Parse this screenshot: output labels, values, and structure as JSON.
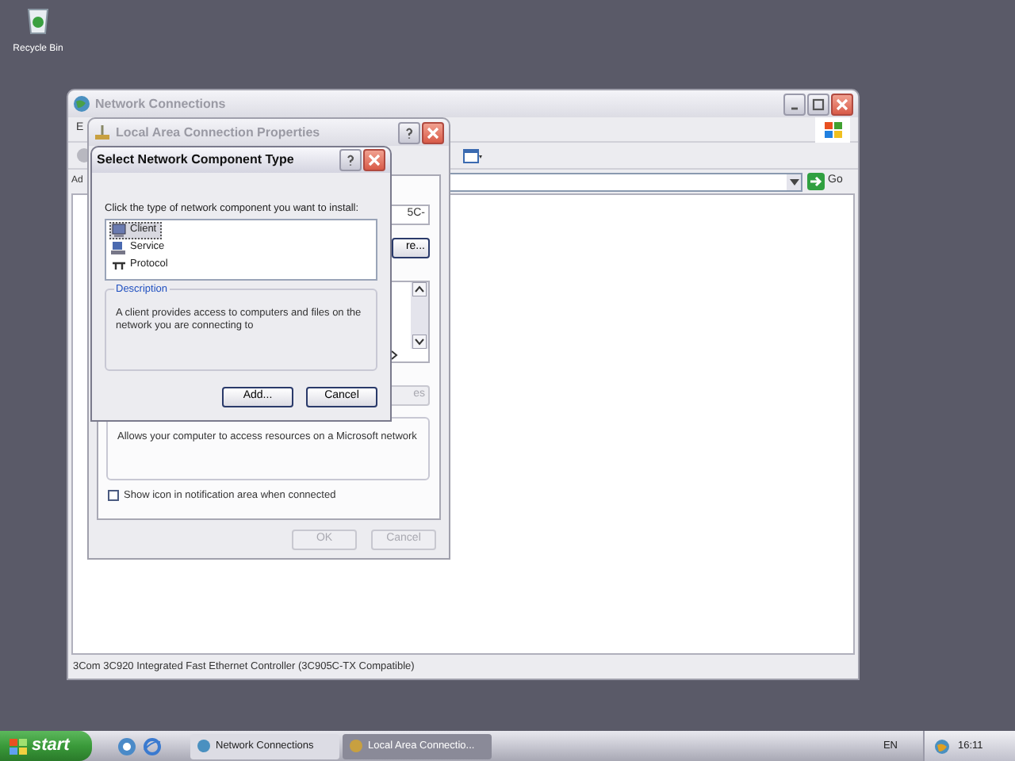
{
  "desktop_icons": [
    {
      "label": "Recycle Bin"
    }
  ],
  "network_connections": {
    "title": "Network Connections",
    "menu": [
      "E"
    ],
    "address_label": "Ad",
    "go": "Go",
    "status_bar": "3Com 3C920 Integrated Fast Ethernet Controller (3C905C-TX Compatible)"
  },
  "properties": {
    "title": "Local Area Connection Properties",
    "adapter_field": "5C-",
    "configure_button": "re...",
    "properties_button": "es",
    "description": "Allows your computer to access resources on a Microsoft network",
    "show_icon": {
      "label": "Show icon in notification area when connected",
      "checked": false
    },
    "buttons": [
      {
        "label": "OK",
        "disabled": true
      },
      {
        "label": "Cancel",
        "disabled": true
      }
    ]
  },
  "dialog": {
    "title": "Select Network Component Type",
    "prompt": "Click the type of network component you want to install:",
    "components": [
      {
        "label": "Client",
        "kind": "client",
        "selected": true
      },
      {
        "label": "Service",
        "kind": "service",
        "selected": false
      },
      {
        "label": "Protocol",
        "kind": "protocol",
        "selected": false
      }
    ],
    "description_title": "Description",
    "description": "A client provides access to computers and files on the network you are connecting to",
    "buttons": [
      {
        "label": "Add..."
      },
      {
        "label": "Cancel"
      }
    ]
  },
  "taskbar": {
    "start": "start",
    "tasks": [
      {
        "label": "Network Connections",
        "selected": false
      },
      {
        "label": "Local Area Connectio...",
        "selected": true
      }
    ],
    "language": "EN",
    "clock": "16:11"
  }
}
